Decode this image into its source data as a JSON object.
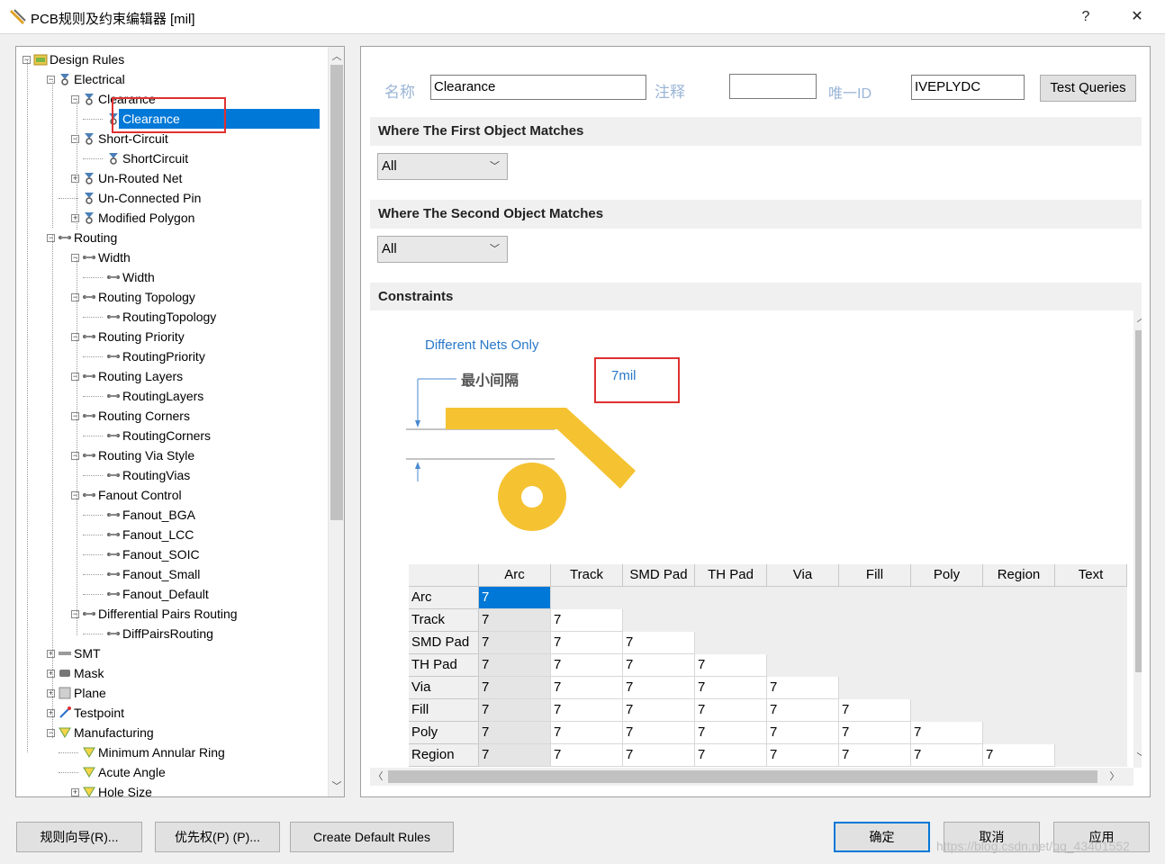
{
  "window": {
    "title": "PCB规则及约束编辑器 [mil]",
    "help_label": "?",
    "close_label": "✕"
  },
  "tree": {
    "nodes": [
      {
        "label": "Design Rules",
        "expander": "−"
      },
      {
        "label": "Electrical",
        "expander": "−"
      },
      {
        "label": "Clearance",
        "expander": "−"
      },
      {
        "label": "Clearance",
        "expander": ""
      },
      {
        "label": "Short-Circuit",
        "expander": "−"
      },
      {
        "label": "ShortCircuit",
        "expander": ""
      },
      {
        "label": "Un-Routed Net",
        "expander": "+"
      },
      {
        "label": "Un-Connected Pin",
        "expander": ""
      },
      {
        "label": "Modified Polygon",
        "expander": "+"
      },
      {
        "label": "Routing",
        "expander": "−"
      },
      {
        "label": "Width",
        "expander": "−"
      },
      {
        "label": "Width",
        "expander": ""
      },
      {
        "label": "Routing Topology",
        "expander": "−"
      },
      {
        "label": "RoutingTopology",
        "expander": ""
      },
      {
        "label": "Routing Priority",
        "expander": "−"
      },
      {
        "label": "RoutingPriority",
        "expander": ""
      },
      {
        "label": "Routing Layers",
        "expander": "−"
      },
      {
        "label": "RoutingLayers",
        "expander": ""
      },
      {
        "label": "Routing Corners",
        "expander": "−"
      },
      {
        "label": "RoutingCorners",
        "expander": ""
      },
      {
        "label": "Routing Via Style",
        "expander": "−"
      },
      {
        "label": "RoutingVias",
        "expander": ""
      },
      {
        "label": "Fanout Control",
        "expander": "−"
      },
      {
        "label": "Fanout_BGA",
        "expander": ""
      },
      {
        "label": "Fanout_LCC",
        "expander": ""
      },
      {
        "label": "Fanout_SOIC",
        "expander": ""
      },
      {
        "label": "Fanout_Small",
        "expander": ""
      },
      {
        "label": "Fanout_Default",
        "expander": ""
      },
      {
        "label": "Differential Pairs Routing",
        "expander": "−"
      },
      {
        "label": "DiffPairsRouting",
        "expander": ""
      },
      {
        "label": "SMT",
        "expander": "+"
      },
      {
        "label": "Mask",
        "expander": "+"
      },
      {
        "label": "Plane",
        "expander": "+"
      },
      {
        "label": "Testpoint",
        "expander": "+"
      },
      {
        "label": "Manufacturing",
        "expander": "−"
      },
      {
        "label": "Minimum Annular Ring",
        "expander": ""
      },
      {
        "label": "Acute Angle",
        "expander": ""
      },
      {
        "label": "Hole Size",
        "expander": "+"
      }
    ]
  },
  "rule": {
    "name_label": "名称",
    "name_value": "Clearance",
    "comment_label": "注释",
    "comment_value": "",
    "uid_label": "唯一ID",
    "uid_value": "IVEPLYDC",
    "test_queries_label": "Test Queries"
  },
  "first_match": {
    "header": "Where The First Object Matches",
    "value": "All"
  },
  "second_match": {
    "header": "Where The Second Object Matches",
    "value": "All"
  },
  "constraints": {
    "header": "Constraints",
    "nets_mode": "Different Nets Only",
    "min_clearance_label": "最小间隔",
    "min_clearance_value": "7mil",
    "matrix": {
      "columns": [
        "Arc",
        "Track",
        "SMD Pad",
        "TH Pad",
        "Via",
        "Fill",
        "Poly",
        "Region",
        "Text"
      ],
      "rows": [
        {
          "label": "Arc",
          "values": [
            "7"
          ]
        },
        {
          "label": "Track",
          "values": [
            "7",
            "7"
          ]
        },
        {
          "label": "SMD Pad",
          "values": [
            "7",
            "7",
            "7"
          ]
        },
        {
          "label": "TH Pad",
          "values": [
            "7",
            "7",
            "7",
            "7"
          ]
        },
        {
          "label": "Via",
          "values": [
            "7",
            "7",
            "7",
            "7",
            "7"
          ]
        },
        {
          "label": "Fill",
          "values": [
            "7",
            "7",
            "7",
            "7",
            "7",
            "7"
          ]
        },
        {
          "label": "Poly",
          "values": [
            "7",
            "7",
            "7",
            "7",
            "7",
            "7",
            "7"
          ]
        },
        {
          "label": "Region",
          "values": [
            "7",
            "7",
            "7",
            "7",
            "7",
            "7",
            "7",
            "7"
          ]
        }
      ]
    }
  },
  "buttons": {
    "rule_wizard": "规则向导(R)...",
    "priorities": "优先权(P) (P)...",
    "create_default": "Create Default Rules",
    "ok": "确定",
    "cancel": "取消",
    "apply": "应用"
  },
  "watermark": "https://blog.csdn.net/qq_43401552",
  "colors": {
    "selection": "#0078d7",
    "highlight_box": "#e03030",
    "graphic_copper": "#f5c232",
    "label_blue": "#2878c8"
  }
}
